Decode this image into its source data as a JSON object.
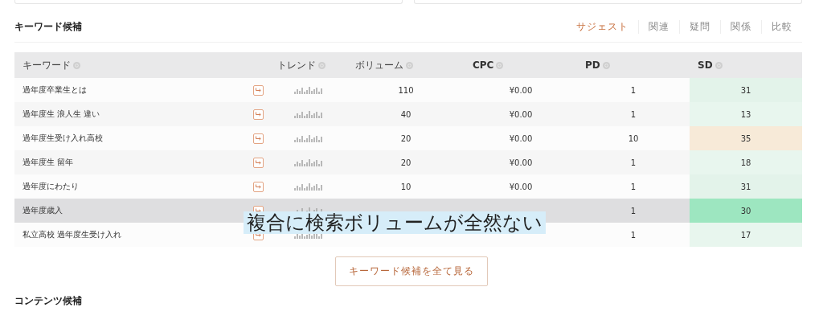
{
  "section_title": "キーワード候補",
  "tabs": [
    {
      "label": "サジェスト",
      "selected": true
    },
    {
      "label": "関連",
      "selected": false
    },
    {
      "label": "疑問",
      "selected": false
    },
    {
      "label": "関係",
      "selected": false
    },
    {
      "label": "比較",
      "selected": false
    }
  ],
  "table": {
    "columns": [
      "キーワード",
      "トレンド",
      "ボリューム",
      "CPC",
      "PD",
      "SD"
    ],
    "rows": [
      {
        "keyword": "過年度卒業生とは",
        "volume": "110",
        "cpc": "¥0.00",
        "pd": "1",
        "sd": "31",
        "color": "#e3f3ea",
        "highlighted": false
      },
      {
        "keyword": "過年度生 浪人生 違い",
        "volume": "40",
        "cpc": "¥0.00",
        "pd": "1",
        "sd": "13",
        "color": "#e8f6ee",
        "highlighted": false
      },
      {
        "keyword": "過年度生受け入れ高校",
        "volume": "20",
        "cpc": "¥0.00",
        "pd": "10",
        "sd": "35",
        "color": "#f7ead8",
        "highlighted": false
      },
      {
        "keyword": "過年度生 留年",
        "volume": "20",
        "cpc": "¥0.00",
        "pd": "1",
        "sd": "18",
        "color": "#e8f6ee",
        "highlighted": false
      },
      {
        "keyword": "過年度にわたり",
        "volume": "10",
        "cpc": "¥0.00",
        "pd": "1",
        "sd": "31",
        "color": "#e3f3ea",
        "highlighted": false
      },
      {
        "keyword": "過年度歳入",
        "pd": "1",
        "sd": "30",
        "color": "#9de6c0",
        "highlighted": true
      },
      {
        "keyword": "私立高校 過年度生受け入れ",
        "pd": "1",
        "sd": "17",
        "color": "#e8f6ee",
        "highlighted": false
      }
    ]
  },
  "caption": "複合に検索ボリュームが全然ない",
  "show_all_button": "キーワード候補を全て見る",
  "next_section_title": "コンテンツ候補"
}
